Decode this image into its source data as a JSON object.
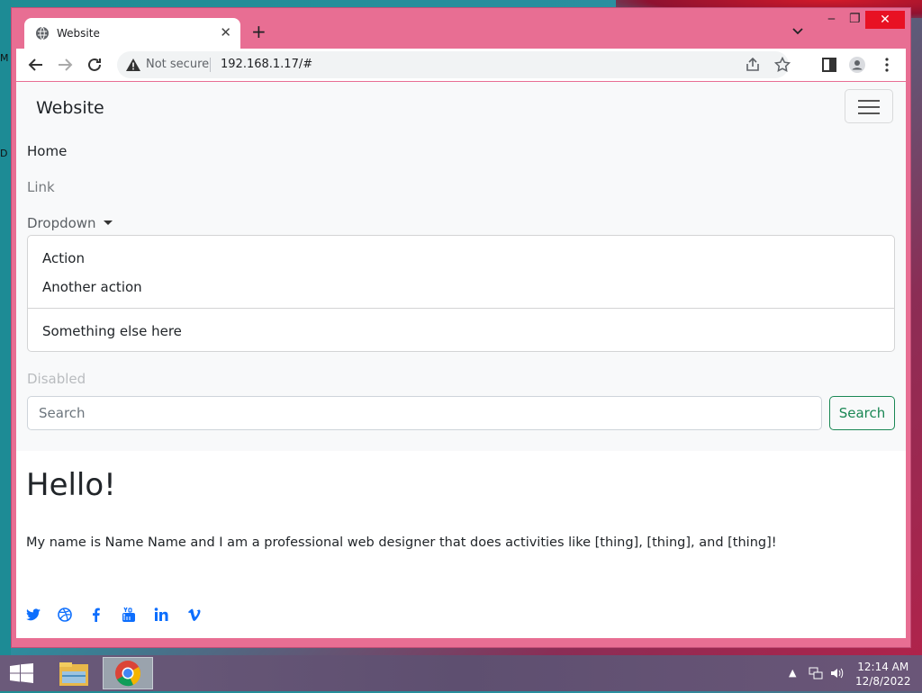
{
  "browser": {
    "tab_title": "Website",
    "new_tab": "+",
    "security_label": "Not secure",
    "url": "192.168.1.17/#"
  },
  "site": {
    "brand": "Website",
    "nav": {
      "home": "Home",
      "link": "Link",
      "dropdown": "Dropdown",
      "disabled": "Disabled"
    },
    "dropdown_items": [
      "Action",
      "Another action",
      "Something else here"
    ],
    "search": {
      "placeholder": "Search",
      "button": "Search"
    },
    "heading": "Hello!",
    "bio": "My name is Name Name and I am a professional web designer that does activities like [thing], [thing], and [thing]!",
    "social_icons": [
      "twitter-icon",
      "dribbble-icon",
      "facebook-icon",
      "youtube-icon",
      "linkedin-icon",
      "vimeo-icon"
    ]
  },
  "colors": {
    "window_frame": "#e86e93",
    "link_blue": "#0d6efd",
    "success_green": "#198754",
    "navbar_bg": "#f8f9fa"
  },
  "taskbar": {
    "time": "12:14 AM",
    "date": "12/8/2022"
  }
}
